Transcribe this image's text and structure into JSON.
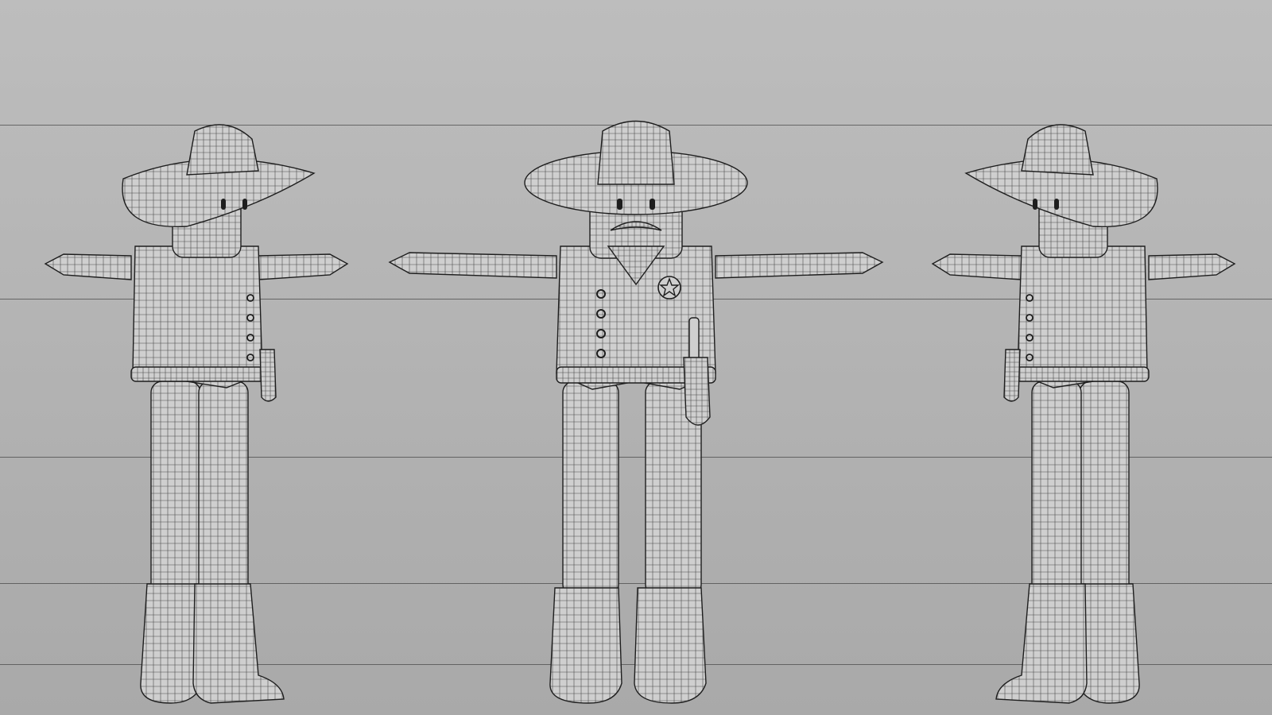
{
  "scene": {
    "type": "character-turnaround",
    "subject": "cowboy-sheriff",
    "render_style": "wireframe-mesh",
    "views": [
      {
        "id": "view-left",
        "label": "three-quarter-left"
      },
      {
        "id": "view-front",
        "label": "front"
      },
      {
        "id": "view-right",
        "label": "three-quarter-right"
      }
    ],
    "guide_line_count": 5,
    "colors": {
      "background": "#b6b6b6",
      "mesh_fill": "#cfcfcf",
      "mesh_shadow": "#a6a6a6",
      "wire": "#2b2b2b",
      "outline": "#1e1e1e"
    },
    "icons": {
      "badge": "sheriff-star-badge-icon",
      "holster": "revolver-holster-icon"
    }
  }
}
